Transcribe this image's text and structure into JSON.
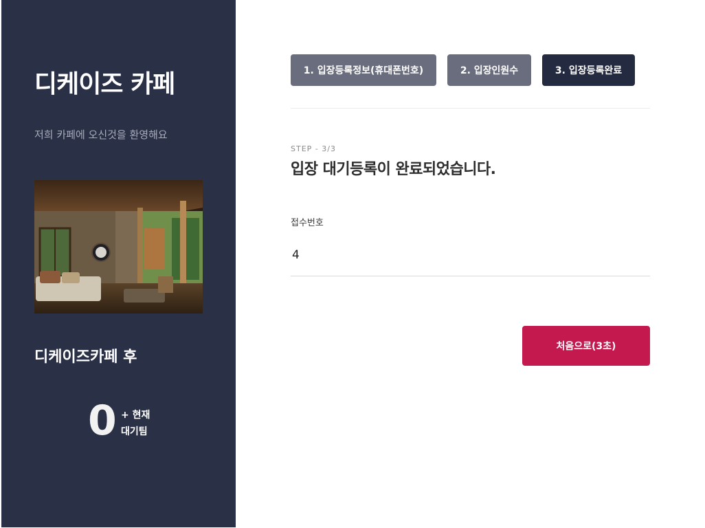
{
  "sidebar": {
    "title": "디케이즈 카페",
    "subtitle": "저희 카페에 오신것을 환영해요",
    "queue_caption": "디케이즈카페 후",
    "queue_count": "0",
    "queue_label_line1": "+ 현재",
    "queue_label_line2": "대기팀"
  },
  "steps": [
    {
      "label": "1. 입장등록정보(휴대폰번호)",
      "active": false
    },
    {
      "label": "2. 입장인원수",
      "active": false
    },
    {
      "label": "3. 입장등록완료",
      "active": true
    }
  ],
  "main": {
    "step_meta": "STEP - 3/3",
    "headline": "입장 대기등록이 완료되었습니다.",
    "field_label": "접수번호",
    "field_value": "4",
    "restart_label": "처음으로(3초)"
  },
  "colors": {
    "sidebar_bg": "#2a3046",
    "step_inactive": "#6a6d7d",
    "step_active": "#242a40",
    "primary_button": "#c4194f"
  }
}
